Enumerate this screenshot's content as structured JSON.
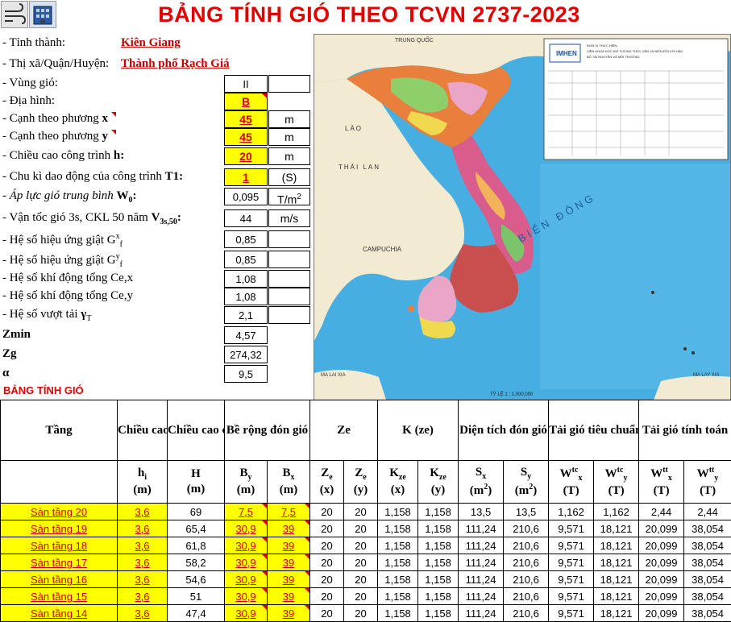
{
  "title": "BẢNG TÍNH GIÓ THEO TCVN 2737-2023",
  "toolbar": {
    "icons": [
      "wind-icon",
      "building-icon"
    ]
  },
  "params": {
    "province": {
      "label": "- Tỉnh thành:",
      "value": "Kiên Giang"
    },
    "district": {
      "label": "- Thị xã/Quận/Huyện:",
      "value": "Thành phố Rạch Giá"
    },
    "wind_zone": {
      "label": "- Vùng gió:",
      "value": "II"
    },
    "terrain": {
      "label": "- Địa hình:",
      "value": "B"
    },
    "side_x": {
      "label": "- Cạnh theo phương ",
      "axis": "x",
      "value": "45",
      "unit": "m"
    },
    "side_y": {
      "label": "- Cạnh theo phương ",
      "axis": "y",
      "value": "45",
      "unit": "m"
    },
    "height": {
      "label": "- Chiều cao công trình ",
      "bold": "h:",
      "value": "20",
      "unit": "m"
    },
    "period": {
      "label": "- Chu kì dao động của công trình ",
      "bold": "T1:",
      "value": "1",
      "unit": "(S)"
    },
    "w0": {
      "label": "- Áp lực gió trung bình ",
      "bold": "W",
      "sub": "0",
      "colon": ":",
      "value": "0,095",
      "unit": "T/m",
      "unit_sup": "2"
    },
    "v3s": {
      "label": "- Vận tốc gió 3s, CKL 50 năm ",
      "bold": "V",
      "sub": "3s,50",
      "colon": ":",
      "value": "44",
      "unit": "m/s"
    },
    "gx": {
      "label": "- Hệ số hiệu ứng giật G",
      "sup": "x",
      "sub": "f",
      "value": "0,85"
    },
    "gy": {
      "label": "- Hệ số hiệu ứng giật G",
      "sup": "y",
      "sub": "f",
      "value": "0,85"
    },
    "cex": {
      "label": "- Hệ số khí động tổng Ce,x",
      "value": "1,08"
    },
    "cey": {
      "label": "- Hệ số khí động tổng Ce,y",
      "value": "1,08"
    },
    "gamma": {
      "label": "- Hệ số vượt tải ",
      "bold": "γ",
      "sub": "T",
      "value": "2,1"
    },
    "zmin": {
      "label": "Zmin",
      "value": "4,57"
    },
    "zg": {
      "label": "Zg",
      "value": "274,32"
    },
    "alpha": {
      "label": "α",
      "value": "9,5"
    }
  },
  "map": {
    "labels": [
      "TRUNG QUỐC",
      "LÀO",
      "THÁI LAN",
      "CAMPUCHIA",
      "BIỂN ĐÔNG",
      "MA LAI XIA",
      "MA LAY XIA"
    ],
    "scale": "TỶ LỆ 1 : 1.000.000",
    "org": "IMHEN",
    "org_text": [
      "ĐƠN VỊ THỰC HIỆN:",
      "VIỆN KHOA HỌC KHÍ TƯỢNG THỦY VĂN VÀ BIẾN ĐỔI KHÍ HẬU",
      "BỘ TÀI NGUYÊN VÀ MÔI TRƯỜNG"
    ]
  },
  "section_label": "BẢNG TÍNH GIÓ",
  "table": {
    "headers": {
      "floor": "Tầng",
      "hi": "Chiều cao tầng",
      "H": "Chiều cao công trình",
      "width": "Bề rộng đón gió",
      "ze": "Ze",
      "kze": "K (ze)",
      "area": "Diện tích đón gió",
      "wtc": "Tải gió tiêu chuẩn",
      "wtt": "Tải gió tính toán"
    },
    "sub": {
      "hi": {
        "main": "h",
        "sub": "i",
        "unit": "(m)"
      },
      "H": {
        "main": "H",
        "unit": "(m)"
      },
      "by": {
        "main": "B",
        "sub": "y",
        "unit": "(m)"
      },
      "bx": {
        "main": "B",
        "sub": "x",
        "unit": "(m)"
      },
      "zex": {
        "main": "Z",
        "sub": "e",
        "unit": "(x)"
      },
      "zey": {
        "main": "Z",
        "sub": "e",
        "unit": "(y)"
      },
      "kx": {
        "main": "K",
        "sub": "ze",
        "unit": "(x)"
      },
      "ky": {
        "main": "K",
        "sub": "ze",
        "unit": "(y)"
      },
      "sx": {
        "main": "S",
        "sub": "x",
        "unit": "(m",
        "unit_sup": "2",
        "unit_end": ")"
      },
      "sy": {
        "main": "S",
        "sub": "y",
        "unit": "(m",
        "unit_sup": "2",
        "unit_end": ")"
      },
      "wtcx": {
        "main": "W",
        "sup": "tc",
        "sub": "x",
        "unit": "(T)"
      },
      "wtcy": {
        "main": "W",
        "sup": "tc",
        "sub": "y",
        "unit": "(T)"
      },
      "wttx": {
        "main": "W",
        "sup": "tt",
        "sub": "x",
        "unit": "(T)"
      },
      "wtty": {
        "main": "W",
        "sup": "tt",
        "sub": "y",
        "unit": "(T)"
      }
    },
    "rows": [
      [
        "Sàn tầng 20",
        "3,6",
        "69",
        "7,5",
        "7,5",
        "20",
        "20",
        "1,158",
        "1,158",
        "13,5",
        "13,5",
        "1,162",
        "1,162",
        "2,44",
        "2,44"
      ],
      [
        "Sàn tầng 19",
        "3,6",
        "65,4",
        "30,9",
        "39",
        "20",
        "20",
        "1,158",
        "1,158",
        "111,24",
        "210,6",
        "9,571",
        "18,121",
        "20,099",
        "38,054"
      ],
      [
        "Sàn tầng 18",
        "3,6",
        "61,8",
        "30,9",
        "39",
        "20",
        "20",
        "1,158",
        "1,158",
        "111,24",
        "210,6",
        "9,571",
        "18,121",
        "20,099",
        "38,054"
      ],
      [
        "Sàn tầng 17",
        "3,6",
        "58,2",
        "30,9",
        "39",
        "20",
        "20",
        "1,158",
        "1,158",
        "111,24",
        "210,6",
        "9,571",
        "18,121",
        "20,099",
        "38,054"
      ],
      [
        "Sàn tầng 16",
        "3,6",
        "54,6",
        "30,9",
        "39",
        "20",
        "20",
        "1,158",
        "1,158",
        "111,24",
        "210,6",
        "9,571",
        "18,121",
        "20,099",
        "38,054"
      ],
      [
        "Sàn tầng 15",
        "3,6",
        "51",
        "30,9",
        "39",
        "20",
        "20",
        "1,158",
        "1,158",
        "111,24",
        "210,6",
        "9,571",
        "18,121",
        "20,099",
        "38,054"
      ],
      [
        "Sàn tầng 14",
        "3,6",
        "47,4",
        "30,9",
        "39",
        "20",
        "20",
        "1,158",
        "1,158",
        "111,24",
        "210,6",
        "9,571",
        "18,121",
        "20,099",
        "38,054"
      ]
    ]
  }
}
